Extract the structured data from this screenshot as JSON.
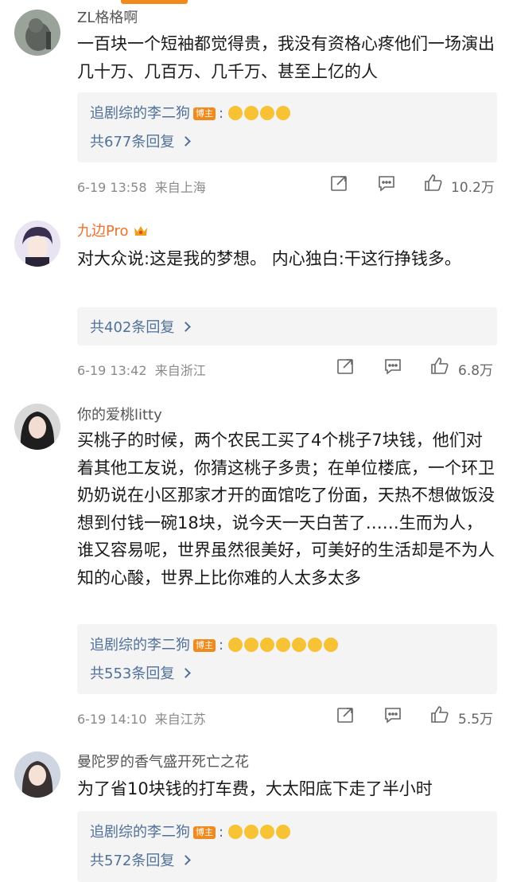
{
  "comments": [
    {
      "username": "ZL格格啊",
      "text": "一百块一个短袖都觉得贵，我没有资格心疼他们一场演出几十万、几百万、几千万、甚至上亿的人",
      "reply": {
        "name": "追剧综的李二狗",
        "badge": "博主",
        "colon": ":",
        "count": "共677条回复"
      },
      "time": "6-19 13:58",
      "location": "来自上海",
      "likes": "10.2万"
    },
    {
      "username": "九边Pro",
      "text": "对大众说:这是我的梦想。 内心独白:干这行挣钱多。",
      "reply": {
        "count": "共402条回复"
      },
      "time": "6-19 13:42",
      "location": "来自浙江",
      "likes": "6.8万"
    },
    {
      "username": "你的爱桃litty",
      "text": "买桃子的时候，两个农民工买了4个桃子7块钱，他们对着其他工友说，你猜这桃子多贵；在单位楼底，一个环卫奶奶说在小区那家才开的面馆吃了份面，天热不想做饭没想到付钱一碗18块，说今天一天白苦了……生而为人，谁又容易呢，世界虽然很美好，可美好的生活却是不为人知的心酸，世界上比你难的人太多太多",
      "reply": {
        "name": "追剧综的李二狗",
        "badge": "博主",
        "colon": ":",
        "count": "共553条回复"
      },
      "time": "6-19 14:10",
      "location": "来自江苏",
      "likes": "5.5万"
    },
    {
      "username": "曼陀罗的香气盛开死亡之花",
      "text": "为了省10块钱的打车费，大太阳底下走了半小时",
      "reply": {
        "name": "追剧综的李二狗",
        "badge": "博主",
        "colon": ":",
        "count": "共572条回复"
      }
    }
  ],
  "colors": {
    "accent": "#f08a1c",
    "link": "#51709a",
    "vip_name": "#f0702a"
  },
  "icons": {
    "share": "share-icon",
    "comment": "comment-icon",
    "like": "thumbs-up-icon"
  }
}
